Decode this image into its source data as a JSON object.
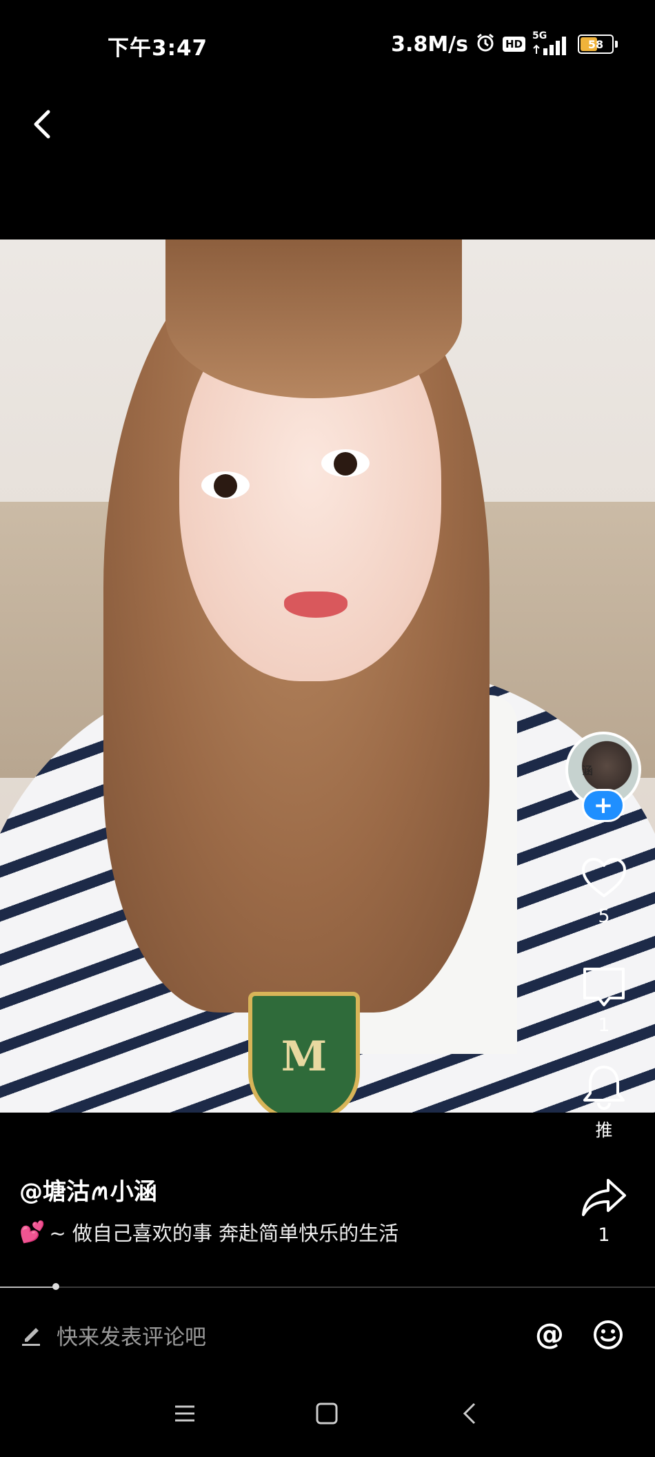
{
  "status_bar": {
    "time": "下午3:47",
    "net_speed": "3.8M/s",
    "hd_label": "HD",
    "network_label": "5G",
    "battery": "58",
    "battery_level": 0.58,
    "battery_color": "#f0b33a"
  },
  "photo": {
    "crest_letter": "M"
  },
  "actions": {
    "avatar_text": "涵",
    "follow_symbol": "+",
    "like_count": "5",
    "comment_count": "1",
    "recommend_label": "推",
    "share_count": "1"
  },
  "post": {
    "author": "@塘沽ꪔ小涵",
    "caption": "~ 做自己喜欢的事 奔赴简单快乐的生活",
    "caption_emoji": "💕"
  },
  "progress": {
    "fraction": 0.085
  },
  "comment_bar": {
    "placeholder": "快来发表评论吧",
    "at_symbol": "@"
  },
  "icons": {
    "back": "chevron-left-icon",
    "like": "heart-icon",
    "comment": "comment-icon",
    "recommend": "bell-icon",
    "share": "share-arrow-icon",
    "edit": "pencil-icon",
    "emoji": "smiley-icon"
  },
  "colors": {
    "accent": "#1f8fff",
    "background": "#000000"
  }
}
